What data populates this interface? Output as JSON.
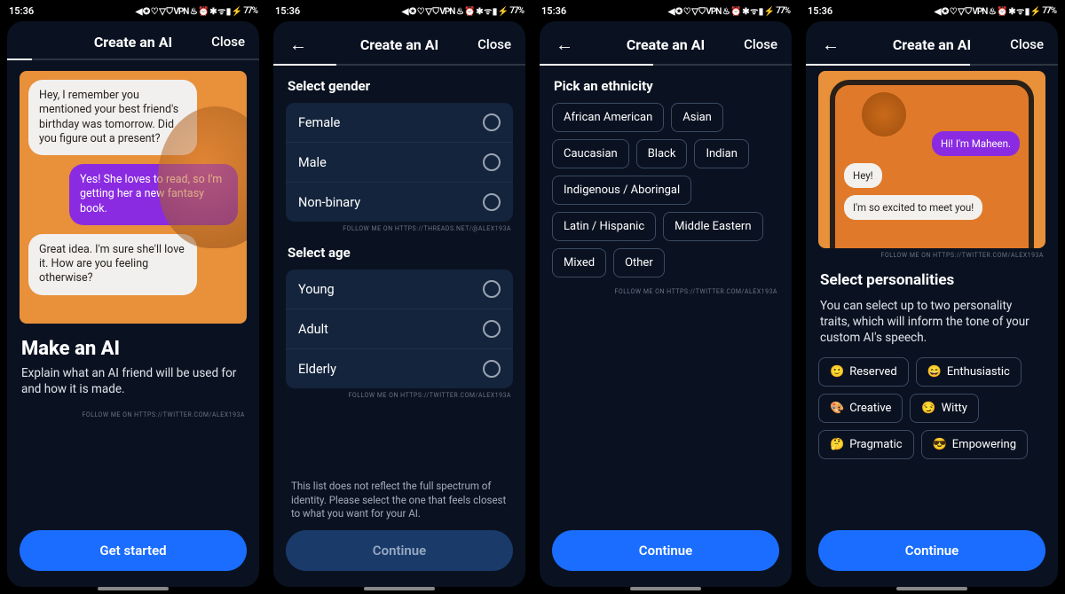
{
  "statusbar": {
    "time": "15:36",
    "battery": "77%"
  },
  "header": {
    "title": "Create an AI",
    "close": "Close"
  },
  "watermark_threads": "FOLLOW ME ON HTTPS://THREADS.NET/@ALEX193A",
  "watermark_twitter": "FOLLOW ME ON HTTPS://TWITTER.COM/ALEX193A",
  "screen1": {
    "bubbles": [
      "Hey, I remember you mentioned your best friend's birthday was tomorrow. Did you figure out a present?",
      "Yes! She loves to read, so I'm getting her a new fantasy book.",
      "Great idea. I'm sure she'll love it. How are you feeling otherwise?"
    ],
    "headline": "Make an AI",
    "body": "Explain what an AI friend will be used for and how it is made.",
    "cta": "Get started"
  },
  "screen2": {
    "gender_title": "Select gender",
    "genders": [
      "Female",
      "Male",
      "Non-binary"
    ],
    "age_title": "Select age",
    "ages": [
      "Young",
      "Adult",
      "Elderly"
    ],
    "footnote": "This list does not reflect the full spectrum of identity.  Please select the one that feels closest to what you want for your AI.",
    "cta": "Continue"
  },
  "screen3": {
    "title": "Pick an ethnicity",
    "options": [
      "African American",
      "Asian",
      "Caucasian",
      "Black",
      "Indian",
      "Indigenous / Aboringal",
      "Latin / Hispanic",
      "Middle Eastern",
      "Mixed",
      "Other"
    ],
    "cta": "Continue"
  },
  "screen4": {
    "bubbles": [
      "Hi! I'm Maheen.",
      "Hey!",
      "I'm so excited to meet you!"
    ],
    "title": "Select personalities",
    "body": "You can select up to two personality traits, which will inform the tone of your custom AI's speech.",
    "options": [
      {
        "emoji": "🙂",
        "label": "Reserved"
      },
      {
        "emoji": "😄",
        "label": "Enthusiastic"
      },
      {
        "emoji": "🎨",
        "label": "Creative"
      },
      {
        "emoji": "😏",
        "label": "Witty"
      },
      {
        "emoji": "🤔",
        "label": "Pragmatic"
      },
      {
        "emoji": "😎",
        "label": "Empowering"
      }
    ],
    "cta": "Continue"
  }
}
